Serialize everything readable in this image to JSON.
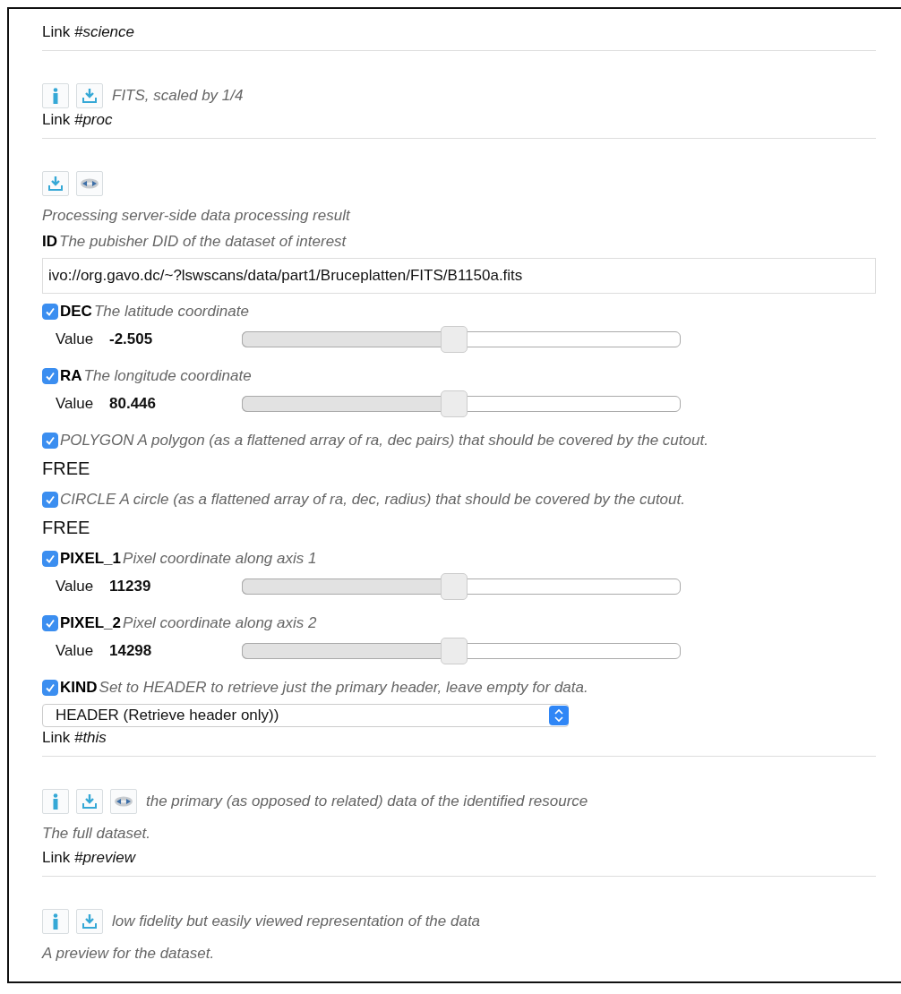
{
  "items": [
    {
      "kind": "link",
      "text": "Link *#science*"
    },
    {
      "kind": "icons",
      "icons": [
        {
          "kind": "info"
        },
        {
          "kind": "download"
        }
      ],
      "text": "FITS, scaled by 1/4"
    },
    {
      "kind": "link",
      "text": "Link *#proc*"
    },
    {
      "kind": "icons",
      "icons": [
        {
          "kind": "download"
        },
        {
          "kind": "disc"
        }
      ]
    },
    {
      "kind": "note",
      "text": "Processing server-side data processing result"
    },
    {
      "kind": "param",
      "name": "ID",
      "description": "The pubisher DID of the dataset of interest",
      "control": {
        "kind": "text",
        "value": "ivo://org.gavo.dc/~?lswscans/data/part1/Bruceplatten/FITS/B1150a.fits"
      }
    },
    {
      "kind": "param",
      "checked": true,
      "name": "DEC",
      "description": "The latitude coordinate",
      "control": {
        "kind": "slider",
        "label": "Value",
        "value": "-2.505",
        "level": 0.5
      }
    },
    {
      "kind": "param",
      "checked": true,
      "name": "RA",
      "description": "The longitude coordinate",
      "control": {
        "kind": "slider",
        "label": "Value",
        "value": "80.446",
        "level": 0.5
      }
    },
    {
      "kind": "param",
      "checked": true,
      "description": "POLYGON A polygon (as a flattened array of ra, dec pairs) that should be covered by the cutout.",
      "control": {
        "kind": "free",
        "text": "FREE"
      }
    },
    {
      "kind": "param",
      "checked": true,
      "description": "CIRCLE A circle (as a flattened array of ra, dec, radius) that should be covered by the cutout.",
      "control": {
        "kind": "free",
        "text": "FREE"
      }
    },
    {
      "kind": "param",
      "checked": true,
      "name": "PIXEL_1",
      "description": "Pixel coordinate along axis 1",
      "control": {
        "kind": "slider",
        "label": "Value",
        "value": "11239",
        "level": 0.5
      }
    },
    {
      "kind": "param",
      "checked": true,
      "name": "PIXEL_2",
      "description": "Pixel coordinate along axis 2",
      "control": {
        "kind": "slider",
        "label": "Value",
        "value": "14298",
        "level": 0.5
      }
    },
    {
      "kind": "param",
      "checked": true,
      "name": "KIND",
      "description": "Set to HEADER to retrieve just the primary header, leave empty for data.",
      "control": {
        "kind": "select",
        "value": "HEADER (Retrieve header only))"
      }
    },
    {
      "kind": "link",
      "text": "Link *#this*"
    },
    {
      "kind": "icons",
      "icons": [
        {
          "kind": "info"
        },
        {
          "kind": "download"
        },
        {
          "kind": "disc"
        }
      ],
      "text": "the primary (as opposed to related) data of the identified resource"
    },
    {
      "kind": "note",
      "text": "The full dataset."
    },
    {
      "kind": "link",
      "text": "Link *#preview*"
    },
    {
      "kind": "icons",
      "icons": [
        {
          "kind": "info"
        },
        {
          "kind": "download"
        }
      ],
      "text": "low fidelity but easily viewed representation of the data"
    },
    {
      "kind": "note",
      "text": "A preview for the dataset."
    }
  ]
}
